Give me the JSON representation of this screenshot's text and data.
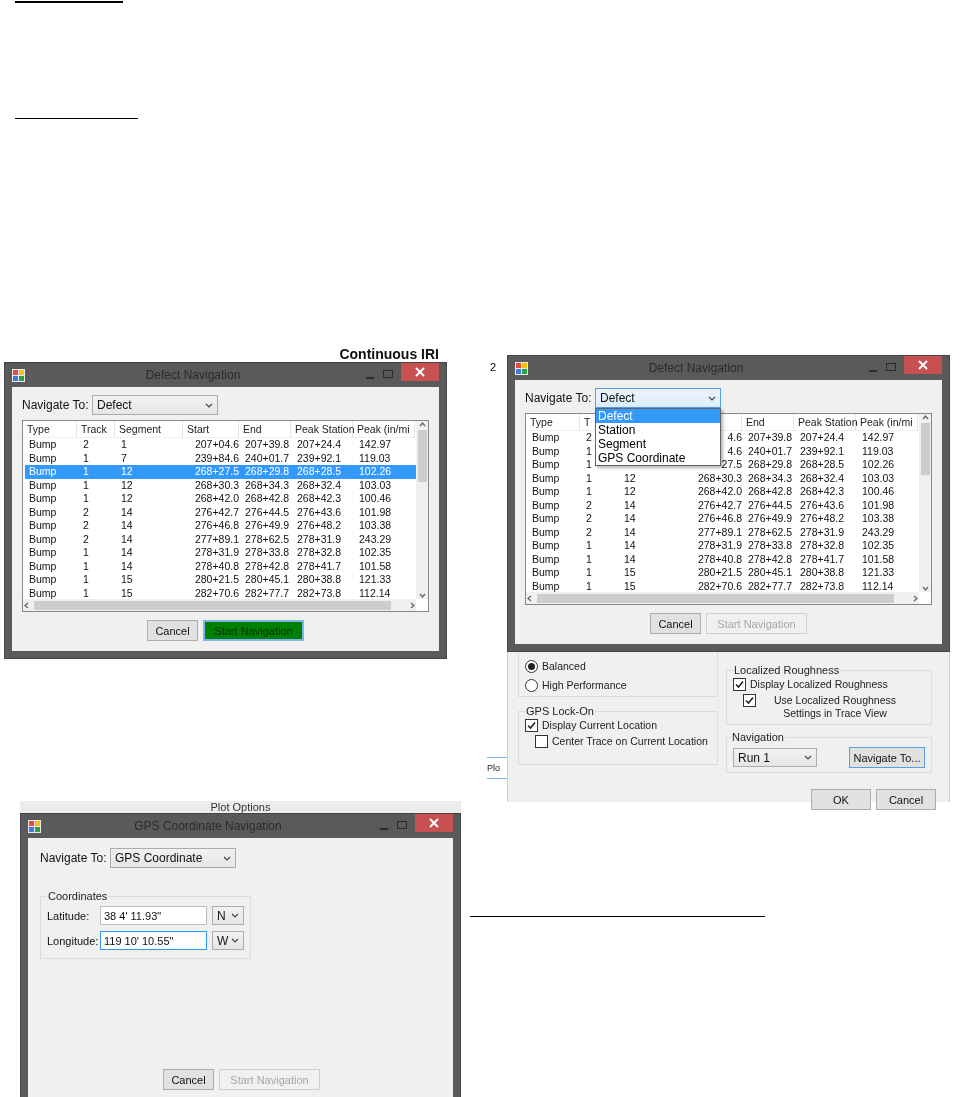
{
  "figure_1": {
    "background_text": "Continuous IRI",
    "dialog": {
      "title": "Defect Navigation",
      "navigate_label": "Navigate To:",
      "navigate_value": "Defect",
      "expanded": false,
      "columns": [
        "Type",
        "Track",
        "Segment",
        "Start",
        "End",
        "Peak Station",
        "Peak (in/mi"
      ],
      "rows": [
        {
          "cells": [
            "Bump",
            "2",
            "1",
            "207+04.6",
            "207+39.8",
            "207+24.4",
            "142.97"
          ],
          "selected": false
        },
        {
          "cells": [
            "Bump",
            "1",
            "7",
            "239+84.6",
            "240+01.7",
            "239+92.1",
            "119.03"
          ],
          "selected": false
        },
        {
          "cells": [
            "Bump",
            "1",
            "12",
            "268+27.5",
            "268+29.8",
            "268+28.5",
            "102.26"
          ],
          "selected": true
        },
        {
          "cells": [
            "Bump",
            "1",
            "12",
            "268+30.3",
            "268+34.3",
            "268+32.4",
            "103.03"
          ],
          "selected": false
        },
        {
          "cells": [
            "Bump",
            "1",
            "12",
            "268+42.0",
            "268+42.8",
            "268+42.3",
            "100.46"
          ],
          "selected": false
        },
        {
          "cells": [
            "Bump",
            "2",
            "14",
            "276+42.7",
            "276+44.5",
            "276+43.6",
            "101.98"
          ],
          "selected": false
        },
        {
          "cells": [
            "Bump",
            "2",
            "14",
            "276+46.8",
            "276+49.9",
            "276+48.2",
            "103.38"
          ],
          "selected": false
        },
        {
          "cells": [
            "Bump",
            "2",
            "14",
            "277+89.1",
            "278+62.5",
            "278+31.9",
            "243.29"
          ],
          "selected": false
        },
        {
          "cells": [
            "Bump",
            "1",
            "14",
            "278+31.9",
            "278+33.8",
            "278+32.8",
            "102.35"
          ],
          "selected": false
        },
        {
          "cells": [
            "Bump",
            "1",
            "14",
            "278+40.8",
            "278+42.8",
            "278+41.7",
            "101.58"
          ],
          "selected": false
        },
        {
          "cells": [
            "Bump",
            "1",
            "15",
            "280+21.5",
            "280+45.1",
            "280+38.8",
            "121.33"
          ],
          "selected": false
        },
        {
          "cells": [
            "Bump",
            "1",
            "15",
            "282+70.6",
            "282+77.7",
            "282+73.8",
            "112.14"
          ],
          "selected": false
        }
      ],
      "buttons": [
        {
          "label": "Cancel",
          "kind": "normal"
        },
        {
          "label": "Start Navigation",
          "kind": "primary"
        }
      ]
    }
  },
  "figure_2": {
    "number": "2",
    "side_tab": "Plo",
    "dialog": {
      "title": "Defect Navigation",
      "navigate_label": "Navigate To:",
      "navigate_value": "Defect",
      "expanded": true,
      "options": [
        {
          "label": "Defect",
          "selected": true
        },
        {
          "label": "Station",
          "selected": false
        },
        {
          "label": "Segment",
          "selected": false
        },
        {
          "label": "GPS Coordinate",
          "selected": false
        }
      ],
      "columns": [
        "Type",
        "T",
        null,
        null,
        "End",
        "Peak Station",
        "Peak (in/mi"
      ],
      "rows": [
        {
          "cells": [
            "Bump",
            "2",
            null,
            "4.6",
            "207+39.8",
            "207+24.4",
            "142.97"
          ],
          "selected": false
        },
        {
          "cells": [
            "Bump",
            "1",
            null,
            "4.6",
            "240+01.7",
            "239+92.1",
            "119.03"
          ],
          "selected": false
        },
        {
          "cells": [
            "Bump",
            "1",
            null,
            "27.5",
            "268+29.8",
            "268+28.5",
            "102.26"
          ],
          "selected": false
        },
        {
          "cells": [
            "Bump",
            "1",
            "12",
            "268+30.3",
            "268+34.3",
            "268+32.4",
            "103.03"
          ],
          "selected": false
        },
        {
          "cells": [
            "Bump",
            "1",
            "12",
            "268+42.0",
            "268+42.8",
            "268+42.3",
            "100.46"
          ],
          "selected": false
        },
        {
          "cells": [
            "Bump",
            "2",
            "14",
            "276+42.7",
            "276+44.5",
            "276+43.6",
            "101.98"
          ],
          "selected": false
        },
        {
          "cells": [
            "Bump",
            "2",
            "14",
            "276+46.8",
            "276+49.9",
            "276+48.2",
            "103.38"
          ],
          "selected": false
        },
        {
          "cells": [
            "Bump",
            "2",
            "14",
            "277+89.1",
            "278+62.5",
            "278+31.9",
            "243.29"
          ],
          "selected": false
        },
        {
          "cells": [
            "Bump",
            "1",
            "14",
            "278+31.9",
            "278+33.8",
            "278+32.8",
            "102.35"
          ],
          "selected": false
        },
        {
          "cells": [
            "Bump",
            "1",
            "14",
            "278+40.8",
            "278+42.8",
            "278+41.7",
            "101.58"
          ],
          "selected": false
        },
        {
          "cells": [
            "Bump",
            "1",
            "15",
            "280+21.5",
            "280+45.1",
            "280+38.8",
            "121.33"
          ],
          "selected": false
        },
        {
          "cells": [
            "Bump",
            "1",
            "15",
            "282+70.6",
            "282+77.7",
            "282+73.8",
            "112.14"
          ],
          "selected": false
        }
      ],
      "buttons": [
        {
          "label": "Cancel",
          "kind": "normal"
        },
        {
          "label": "Start Navigation",
          "kind": "disabled"
        }
      ]
    },
    "plot_options": {
      "modes": [
        {
          "label": "Balanced",
          "selected": true
        },
        {
          "label": "High Performance",
          "selected": false
        }
      ],
      "gps_group": {
        "title": "GPS Lock-On",
        "options": [
          {
            "label": "Display Current Location",
            "checked": true,
            "children": [
              {
                "label": "Center Trace on Current Location",
                "checked": false
              }
            ]
          }
        ]
      },
      "roughness_group": {
        "title": "Localized Roughness",
        "options": [
          {
            "label": "Display Localized Roughness",
            "checked": true,
            "children": [
              {
                "label": "Use Localized Roughness Settings in Trace View",
                "checked": true
              }
            ]
          }
        ]
      },
      "navigation_group": {
        "title": "Navigation",
        "run": "Run 1",
        "button": "Navigate To..."
      },
      "buttons": [
        "OK",
        "Cancel"
      ]
    }
  },
  "figure_3": {
    "back_title": "Plot Options",
    "dialog": {
      "title": "GPS Coordinate Navigation",
      "navigate_label": "Navigate To:",
      "navigate_value": "GPS Coordinate",
      "group": "Coordinates",
      "fields": [
        {
          "label": "Latitude:",
          "value": "38 4' 11.93\"",
          "hemisphere": "N",
          "focused": false
        },
        {
          "label": "Longitude:",
          "value": "119 10' 10.55\"",
          "hemisphere": "W",
          "focused": true
        }
      ],
      "buttons": [
        {
          "label": "Cancel",
          "kind": "normal"
        },
        {
          "label": "Start Navigation",
          "kind": "disabled"
        }
      ]
    }
  }
}
